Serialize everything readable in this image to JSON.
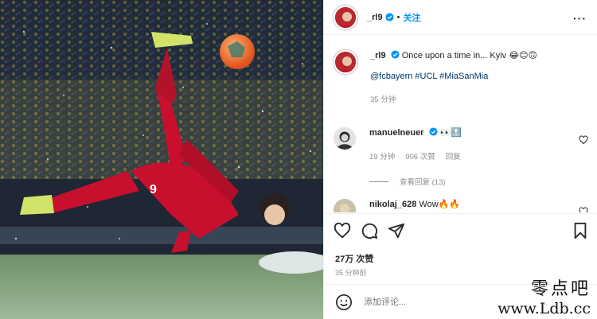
{
  "post": {
    "username": "_rl9",
    "follow_label": "关注",
    "more_label": "···",
    "caption": "Once upon a time in... Kyiv 😂😊🙃",
    "hashtags": "@fcbayern #UCL #MiaSanMia",
    "caption_time": "35 分钟"
  },
  "comments": [
    {
      "username": "manuelneuer",
      "text": "👀🔝",
      "time": "19 分钟",
      "likes": "906 次赞",
      "reply_label": "回复",
      "view_replies": "查看回复 (13)"
    },
    {
      "username": "nikolaj_628",
      "text": "Wow🔥🔥"
    }
  ],
  "actions": {
    "likes": "27万 次赞",
    "time": "35 分钟前",
    "add_comment_placeholder": "添加评论..."
  },
  "watermark": {
    "line1": "零点吧",
    "line2": "www.Ldb.cc"
  },
  "colors": {
    "link_blue": "#0095f6",
    "hashtag": "#00376b",
    "muted": "#8e8e8e",
    "jersey_red": "#c8102e"
  },
  "icons": [
    "verified-badge-icon",
    "heart-icon",
    "comment-icon",
    "share-icon",
    "bookmark-icon",
    "emoji-icon",
    "more-icon"
  ]
}
